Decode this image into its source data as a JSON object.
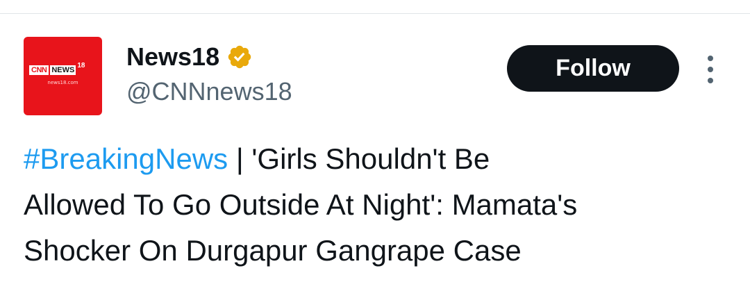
{
  "account": {
    "avatar_brand": {
      "cnn": "CNN",
      "news": "NEWS",
      "number": "18",
      "site": "news18.com"
    },
    "display_name": "News18",
    "verified": true,
    "verified_badge_color": "#e9a90b",
    "handle": "@CNNnews18"
  },
  "actions": {
    "follow_label": "Follow",
    "more_icon": "more-vertical-icon"
  },
  "tweet": {
    "hashtag": "#BreakingNews",
    "text_line1": " | 'Girls Shouldn't Be",
    "text_line2": "Allowed To Go Outside At Night': Mamata's",
    "text_line3": "Shocker On Durgapur Gangrape Case"
  },
  "colors": {
    "accent_link": "#1d9bf0",
    "button_bg": "#0f1419",
    "avatar_bg": "#e8141b",
    "secondary_text": "#536471"
  }
}
